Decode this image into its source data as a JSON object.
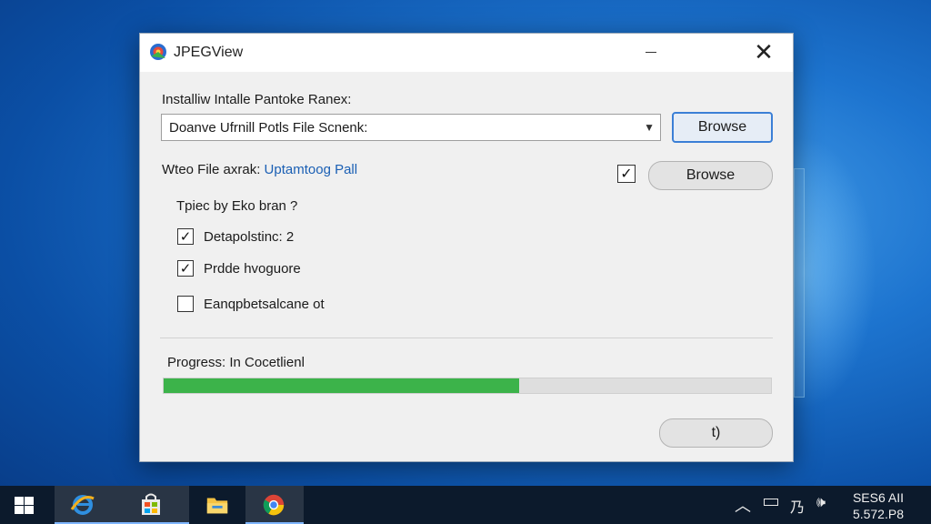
{
  "window": {
    "title": "JPEGView",
    "close_glyph": "✕",
    "install_label": "Installiw Intalle Pantoke Ranex:",
    "install_combo_value": "Doanve Ufrnill Potls File Scnenk:",
    "browse_1_label": "Browse",
    "wteo_label": "Wteo File axrak:",
    "wteo_link": "Uptamtoog Pall",
    "wteo_checked": true,
    "browse_2_label": "Browse",
    "options_heading": "Tpiec by Eko bran ?",
    "options": [
      {
        "label": "Detapolstinc: 2",
        "checked": true
      },
      {
        "label": "Prdde hvoguore",
        "checked": true
      },
      {
        "label": "Eanqpbetsalcane ot",
        "checked": false
      }
    ],
    "progress_label": "Progress: In Cocetlienl",
    "progress_value": 0.585,
    "action_button_label": "t)"
  },
  "taskbar": {
    "tray_icons": [
      "chevron-up-icon",
      "battery-icon",
      "language-icon",
      "volume-icon"
    ],
    "language_glyph": "乃",
    "time": "SES6 AII",
    "date": "5.572.P8"
  },
  "colors": {
    "accent": "#3b7fd6",
    "progress": "#3cb34a",
    "link": "#1a5fb4"
  }
}
